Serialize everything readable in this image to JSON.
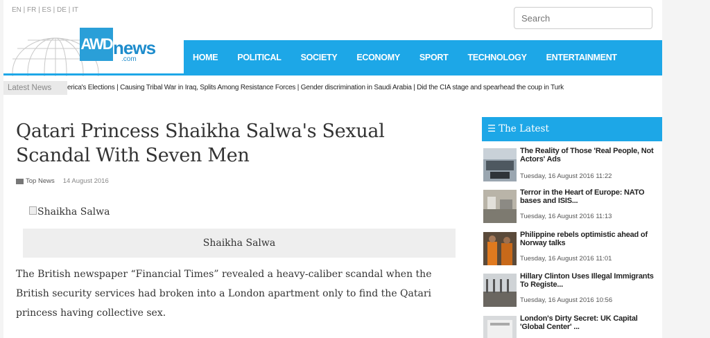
{
  "header": {
    "languages": "EN | FR | ES | DE | IT",
    "search_placeholder": "Search",
    "logo": {
      "mark": "AWD",
      "name": "news",
      "suffix": ".com"
    }
  },
  "nav": {
    "items": [
      "HOME",
      "POLITICAL",
      "SOCIETY",
      "ECONOMY",
      "SPORT",
      "TECHNOLOGY",
      "ENTERTAINMENT"
    ]
  },
  "ticker": {
    "label": "Latest News",
    "text": "erica's Elections | Causing Tribal War in Iraq, Splits Among Resistance Forces | Gender discrimination in Saudi Arabia | Did the CIA stage and spearhead the coup in Turk"
  },
  "article": {
    "title": "Qatari Princess Shaikha Salwa's Sexual Scandal With Seven Men",
    "category": "Top News",
    "date": "14 August 2016",
    "image_alt": "Shaikha Salwa",
    "caption": "Shaikha Salwa",
    "body": "The British newspaper “Financial Times” revealed a heavy-caliber scandal when the British security services had broken into a London apartment only to find the Qatari princess having collective sex."
  },
  "sidebar": {
    "heading": "The Latest",
    "items": [
      {
        "title": "The Reality of Those 'Real People, Not Actors' Ads",
        "date": "Tuesday, 16 August 2016 11:22"
      },
      {
        "title": "Terror in the Heart of Europe: NATO bases and ISIS...",
        "date": "Tuesday, 16 August 2016 11:13"
      },
      {
        "title": "Philippine rebels optimistic ahead of Norway talks",
        "date": "Tuesday, 16 August 2016 11:01"
      },
      {
        "title": "Hillary Clinton Uses Illegal Immigrants To Registe...",
        "date": "Tuesday, 16 August 2016 10:56"
      },
      {
        "title": "London's Dirty Secret: UK Capital 'Global Center' ...",
        "date": ""
      }
    ]
  },
  "colors": {
    "accent": "#1da7e7",
    "logo_blue": "#2a9fd8"
  }
}
